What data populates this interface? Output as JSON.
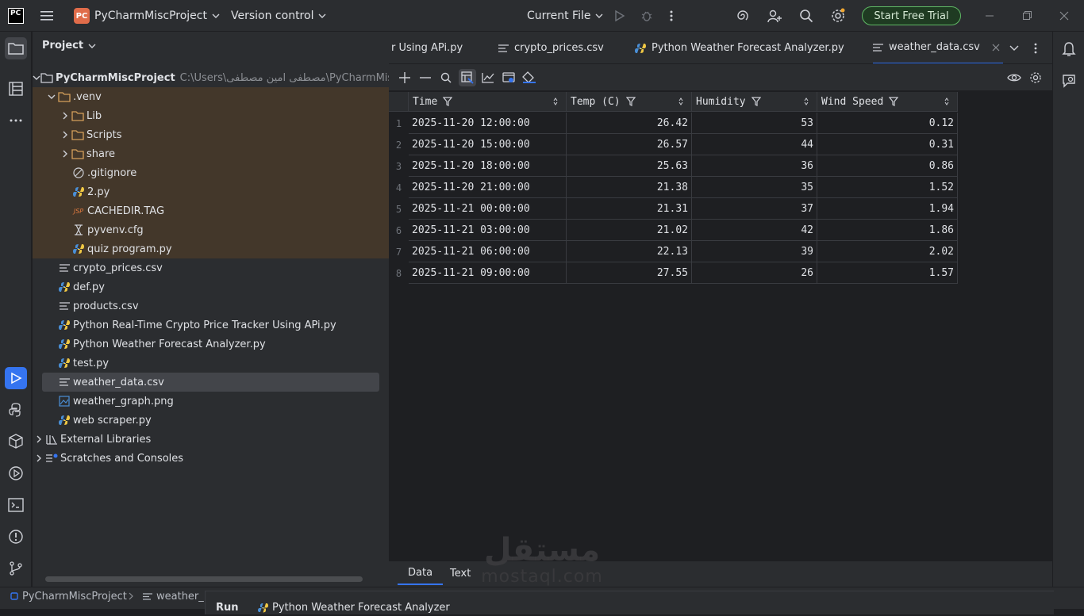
{
  "titlebar": {
    "app_logo": "PC",
    "project_badge": "PC",
    "project_name": "PyCharmMiscProject",
    "version_control": "Version control",
    "run_config": "Current File",
    "trial_button": "Start Free Trial"
  },
  "project_panel": {
    "title": "Project",
    "root_name": "PyCharmMiscProject",
    "root_path": "C:\\Users\\مصطفى امين مصطفى\\PyCharmMiscProject",
    "tree": [
      {
        "label": ".venv",
        "icon": "folder-icon",
        "expanded": true
      },
      {
        "label": "Lib",
        "icon": "folder-icon"
      },
      {
        "label": "Scripts",
        "icon": "folder-icon"
      },
      {
        "label": "share",
        "icon": "folder-icon"
      },
      {
        "label": ".gitignore",
        "icon": "gitignore-icon"
      },
      {
        "label": "2.py",
        "icon": "python-file-icon"
      },
      {
        "label": "CACHEDIR.TAG",
        "icon": "jsp-file-icon",
        "icon_text": "JSP"
      },
      {
        "label": "pyvenv.cfg",
        "icon": "config-file-icon"
      },
      {
        "label": "quiz program.py",
        "icon": "python-file-icon"
      },
      {
        "label": "crypto_prices.csv",
        "icon": "text-file-icon"
      },
      {
        "label": "def.py",
        "icon": "python-file-icon"
      },
      {
        "label": "products.csv",
        "icon": "text-file-icon"
      },
      {
        "label": "Python Real-Time Crypto Price Tracker Using APi.py",
        "icon": "python-file-icon"
      },
      {
        "label": "Python Weather Forecast Analyzer.py",
        "icon": "python-file-icon"
      },
      {
        "label": "test.py",
        "icon": "python-file-icon"
      },
      {
        "label": "weather_data.csv",
        "icon": "text-file-icon",
        "selected": true
      },
      {
        "label": "weather_graph.png",
        "icon": "image-file-icon"
      },
      {
        "label": "web scraper.py",
        "icon": "python-file-icon"
      },
      {
        "label": "External Libraries",
        "icon": "libraries-icon"
      },
      {
        "label": "Scratches and Consoles",
        "icon": "scratches-icon"
      }
    ]
  },
  "editor": {
    "tabs": [
      {
        "label": "Python Real-Time Crypto Price Tracker Using APi.py",
        "visible_label": "r Using APi.py",
        "icon": "python-file-icon"
      },
      {
        "label": "crypto_prices.csv",
        "icon": "text-file-icon"
      },
      {
        "label": "Python Weather Forecast Analyzer.py",
        "icon": "python-file-icon"
      },
      {
        "label": "weather_data.csv",
        "icon": "text-file-icon",
        "active": true
      }
    ],
    "grid": {
      "columns": [
        "Time",
        "Temp (C)",
        "Humidity",
        "Wind Speed"
      ],
      "rows": [
        {
          "n": "1",
          "time": "2025-11-20 12:00:00",
          "temp": "26.42",
          "humidity": "53",
          "wind": "0.12"
        },
        {
          "n": "2",
          "time": "2025-11-20 15:00:00",
          "temp": "26.57",
          "humidity": "44",
          "wind": "0.31"
        },
        {
          "n": "3",
          "time": "2025-11-20 18:00:00",
          "temp": "25.63",
          "humidity": "36",
          "wind": "0.86"
        },
        {
          "n": "4",
          "time": "2025-11-20 21:00:00",
          "temp": "21.38",
          "humidity": "35",
          "wind": "1.52"
        },
        {
          "n": "5",
          "time": "2025-11-21 00:00:00",
          "temp": "21.31",
          "humidity": "37",
          "wind": "1.94"
        },
        {
          "n": "6",
          "time": "2025-11-21 03:00:00",
          "temp": "21.02",
          "humidity": "42",
          "wind": "1.86"
        },
        {
          "n": "7",
          "time": "2025-11-21 06:00:00",
          "temp": "22.13",
          "humidity": "39",
          "wind": "2.02"
        },
        {
          "n": "8",
          "time": "2025-11-21 09:00:00",
          "temp": "27.55",
          "humidity": "26",
          "wind": "1.57"
        }
      ]
    },
    "bottom_tabs": [
      "Data",
      "Text"
    ]
  },
  "statusbar": {
    "project": "PyCharmMiscProject",
    "file": "weather_",
    "run_label": "Run",
    "run_config": "Python Weather Forecast Analyzer"
  },
  "watermark": {
    "arabic": "مستقل",
    "latin": "mostaql.com"
  },
  "colors": {
    "accent": "#3574f0",
    "folder": "#d5a05b",
    "python_blue": "#4a8fd6",
    "python_yellow": "#f0c844",
    "trial_green": "#5fb865"
  }
}
